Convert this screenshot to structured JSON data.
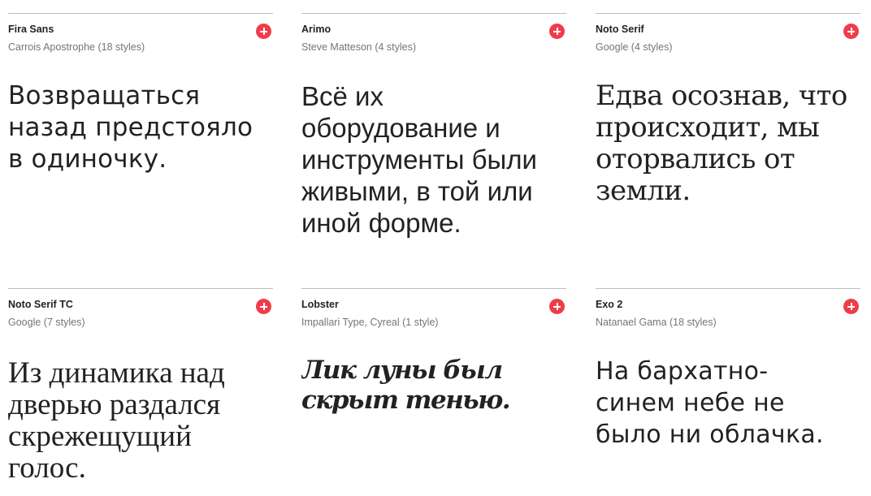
{
  "colors": {
    "add_button": "#ef3c4b",
    "divider": "#bdbdbd",
    "name_text": "#222222",
    "author_text": "#757575"
  },
  "cards": [
    {
      "name": "Fira Sans",
      "author": "Carrois Apostrophe (18 styles)",
      "sample": "Возвращаться назад предстояло в одиночку.",
      "add_icon": "plus-icon"
    },
    {
      "name": "Arimo",
      "author": "Steve Matteson (4 styles)",
      "sample": "Всё их оборудование и инструменты были живыми, в той или иной форме.",
      "add_icon": "plus-icon"
    },
    {
      "name": "Noto Serif",
      "author": "Google (4 styles)",
      "sample": "Едва осознав, что происходит, мы оторвались от земли.",
      "add_icon": "plus-icon"
    },
    {
      "name": "Noto Serif TC",
      "author": "Google (7 styles)",
      "sample": "Из динамика над дверью раздался скрежещущий голос.",
      "add_icon": "plus-icon"
    },
    {
      "name": "Lobster",
      "author": "Impallari Type, Cyreal (1 style)",
      "sample": "Лик луны был скрыт тенью.",
      "add_icon": "plus-icon"
    },
    {
      "name": "Exo 2",
      "author": "Natanael Gama (18 styles)",
      "sample": "На бархатно-синем небе не было ни облачка.",
      "add_icon": "plus-icon"
    }
  ]
}
